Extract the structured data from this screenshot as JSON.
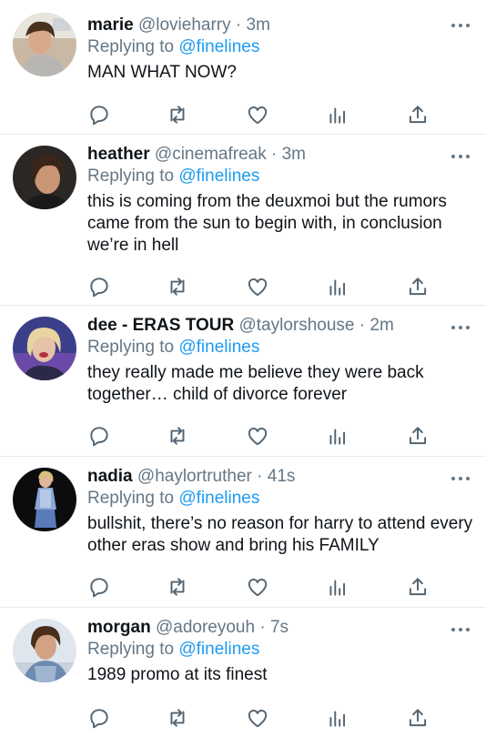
{
  "tweets": [
    {
      "name": "marie",
      "handle": "@lovieharry",
      "dot": "·",
      "time": "3m",
      "replying_prefix": "Replying to",
      "replying_to": "@finelines",
      "text": "MAN WHAT NOW?",
      "avatar_icon": "avatar-photo-person"
    },
    {
      "name": "heather",
      "handle": "@cinemafreak",
      "dot": "·",
      "time": "3m",
      "replying_prefix": "Replying to",
      "replying_to": "@finelines",
      "text": "this is coming from the deuxmoi but the rumors came from the sun to begin with, in conclusion we’re in hell",
      "avatar_icon": "avatar-photo-person"
    },
    {
      "name": "dee - ERAS TOUR",
      "handle": "@taylorshouse",
      "dot": "·",
      "time": "2m",
      "replying_prefix": "Replying to",
      "replying_to": "@finelines",
      "text": "they really made me believe they were back together… child of divorce forever",
      "avatar_icon": "avatar-photo-person"
    },
    {
      "name": "nadia",
      "handle": "@haylortruther",
      "dot": "·",
      "time": "41s",
      "replying_prefix": "Replying to",
      "replying_to": "@finelines",
      "text": "bullshit, there’s no reason for harry to attend every other eras show and bring his FAMILY",
      "avatar_icon": "avatar-photo-person"
    },
    {
      "name": "morgan",
      "handle": "@adoreyouh",
      "dot": "·",
      "time": "7s",
      "replying_prefix": "Replying to",
      "replying_to": "@finelines",
      "text": "1989 promo at its finest",
      "avatar_icon": "avatar-photo-person"
    }
  ],
  "action_icons": [
    "reply-icon",
    "retweet-icon",
    "like-icon",
    "analytics-icon",
    "share-icon"
  ],
  "colors": {
    "text": "#0f1419",
    "secondary": "#657786",
    "mention": "#1d9bf0",
    "divider": "#e6ecf0",
    "icon": "#536471"
  }
}
